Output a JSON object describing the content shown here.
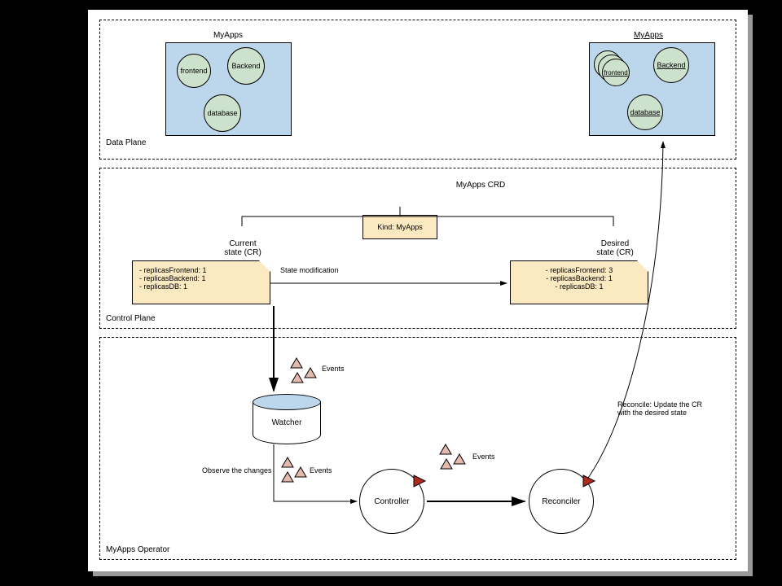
{
  "sections": {
    "data_plane": "Data Plane",
    "control_plane": "Control Plane",
    "operator": "MyApps Operator"
  },
  "data_plane": {
    "left_title": "MyApps",
    "right_title": "MyApps",
    "circles": {
      "frontend": "frontend",
      "backend": "Backend",
      "database": "database"
    }
  },
  "control_plane": {
    "crd_title": "MyApps CRD",
    "kind_box": "Kind: MyApps",
    "current_label_l1": "Current",
    "current_label_l2": "state (CR)",
    "desired_label_l1": "Desired",
    "desired_label_l2": "state (CR)",
    "state_mod": "State modification",
    "current_note": {
      "l1": "- replicasFrontend: 1",
      "l2": "- replicasBackend: 1",
      "l3": "- replicasDB: 1"
    },
    "desired_note": {
      "l1": "- replicasFrontend: 3",
      "l2": "- replicasBackend: 1",
      "l3": "- replicasDB: 1"
    }
  },
  "operator": {
    "watcher": "Watcher",
    "controller": "Controller",
    "reconciler": "Reconciler",
    "events": "Events",
    "observe": "Observe the changes",
    "reconcile_l1": "Reconcile: Update the CR",
    "reconcile_l2": "with the desired state"
  }
}
